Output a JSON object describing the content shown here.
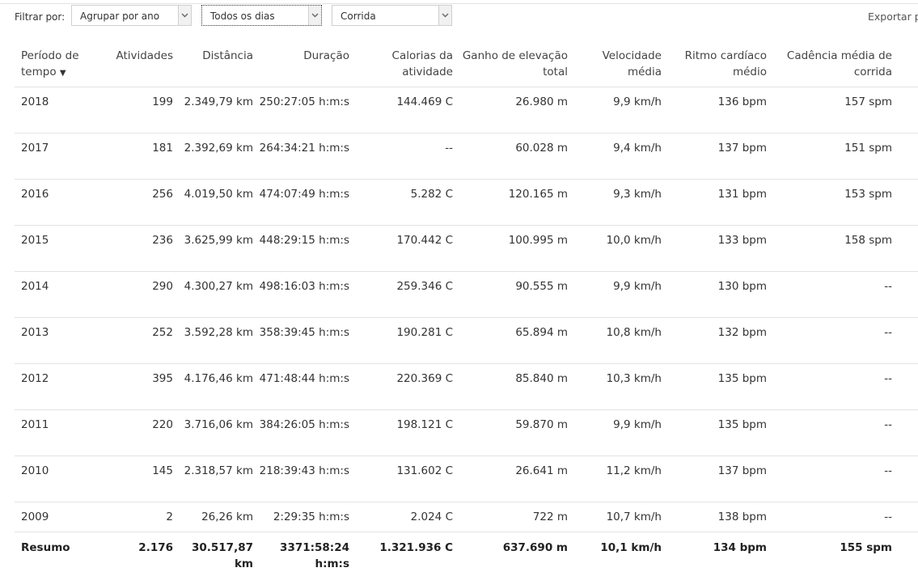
{
  "filters": {
    "label": "Filtrar por:",
    "group_by": "Agrupar por ano",
    "days": "Todos os dias",
    "activity": "Corrida"
  },
  "export_label": "Exportar para CSV",
  "table": {
    "sort_indicator": "▼",
    "columns": [
      "Período de tempo",
      "Atividades",
      "Distância",
      "Duração",
      "Calorias da atividade",
      "Ganho de elevação total",
      "Velocidade média",
      "Ritmo cardíaco médio",
      "Cadência média de corrida"
    ],
    "rows": [
      [
        "2018",
        "199",
        "2.349,79 km",
        "250:27:05 h:m:s",
        "144.469 C",
        "26.980 m",
        "9,9 km/h",
        "136 bpm",
        "157 spm"
      ],
      [
        "2017",
        "181",
        "2.392,69 km",
        "264:34:21 h:m:s",
        "--",
        "60.028 m",
        "9,4 km/h",
        "137 bpm",
        "151 spm"
      ],
      [
        "2016",
        "256",
        "4.019,50 km",
        "474:07:49 h:m:s",
        "5.282 C",
        "120.165 m",
        "9,3 km/h",
        "131 bpm",
        "153 spm"
      ],
      [
        "2015",
        "236",
        "3.625,99 km",
        "448:29:15 h:m:s",
        "170.442 C",
        "100.995 m",
        "10,0 km/h",
        "133 bpm",
        "158 spm"
      ],
      [
        "2014",
        "290",
        "4.300,27 km",
        "498:16:03 h:m:s",
        "259.346 C",
        "90.555 m",
        "9,9 km/h",
        "130 bpm",
        "--"
      ],
      [
        "2013",
        "252",
        "3.592,28 km",
        "358:39:45 h:m:s",
        "190.281 C",
        "65.894 m",
        "10,8 km/h",
        "132 bpm",
        "--"
      ],
      [
        "2012",
        "395",
        "4.176,46 km",
        "471:48:44 h:m:s",
        "220.369 C",
        "85.840 m",
        "10,3 km/h",
        "135 bpm",
        "--"
      ],
      [
        "2011",
        "220",
        "3.716,06 km",
        "384:26:05 h:m:s",
        "198.121 C",
        "59.870 m",
        "9,9 km/h",
        "135 bpm",
        "--"
      ],
      [
        "2010",
        "145",
        "2.318,57 km",
        "218:39:43 h:m:s",
        "131.602 C",
        "26.641 m",
        "11,2 km/h",
        "137 bpm",
        "--"
      ],
      [
        "2009",
        "2",
        "26,26 km",
        "2:29:35 h:m:s",
        "2.024 C",
        "722 m",
        "10,7 km/h",
        "138 bpm",
        "--"
      ]
    ],
    "summary": [
      "Resumo",
      "2.176",
      "30.517,87 km",
      "3371:58:24 h:m:s",
      "1.321.936 C",
      "637.690 m",
      "10,1 km/h",
      "134 bpm",
      "155 spm"
    ]
  }
}
